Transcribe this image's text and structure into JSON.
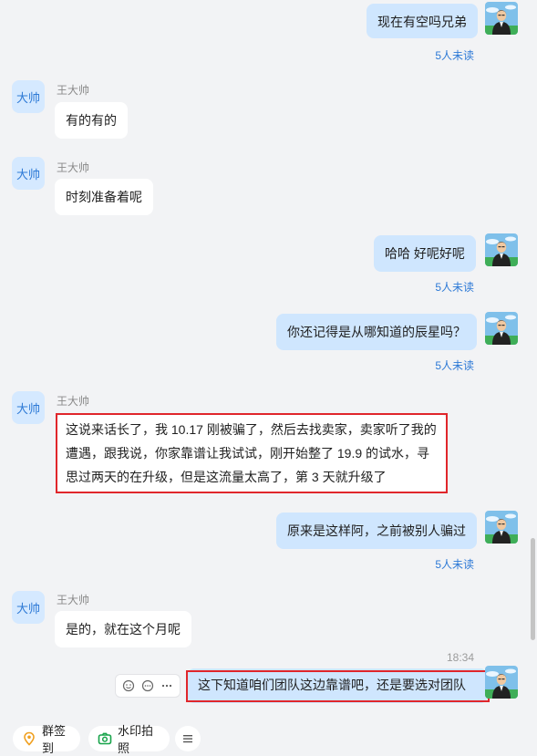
{
  "contact": {
    "name": "王大帅",
    "avatar_label": "大帅"
  },
  "messages": [
    {
      "dir": "out",
      "text": "现在有空吗兄弟",
      "read": "5人未读"
    },
    {
      "dir": "in",
      "text": "有的有的"
    },
    {
      "dir": "in",
      "text": "时刻准备着呢"
    },
    {
      "dir": "out",
      "text": "哈哈 好呢好呢",
      "read": "5人未读"
    },
    {
      "dir": "out",
      "text": "你还记得是从哪知道的辰星吗？",
      "read": "5人未读"
    },
    {
      "dir": "in",
      "lines": [
        "这说来话长了，我 10.17 刚被骗了，然后去找卖家，卖家听了我的",
        "遭遇，跟我说，你家靠谱让我试试，刚开始整了 19.9 的试水，寻",
        "思过两天的在升级，但是这流量太高了，第 3 天就升级了"
      ],
      "highlighted": true
    },
    {
      "dir": "out",
      "text": "原来是这样阿，之前被别人骗过",
      "read": "5人未读"
    },
    {
      "dir": "in",
      "text": "是的，就在这个月呢"
    },
    {
      "dir": "out",
      "text": "这下知道咱们团队这边靠谱吧，还是要选对团队",
      "time": "18:34",
      "highlighted": true
    }
  ],
  "hover_actions": [
    "emoji-react-icon",
    "reply-icon",
    "more-icon"
  ],
  "toolbar": {
    "checkin_label": "群签到",
    "photo_label": "水印拍照",
    "menu_icon": "menu-icon"
  },
  "colors": {
    "background": "#f2f3f5",
    "bubble_out": "#cfe6fe",
    "bubble_in": "#ffffff",
    "unread_text": "#2e7ad6",
    "highlight_box": "#e0262b",
    "checkin_icon": "#f0a020",
    "photo_icon": "#17a34a"
  }
}
